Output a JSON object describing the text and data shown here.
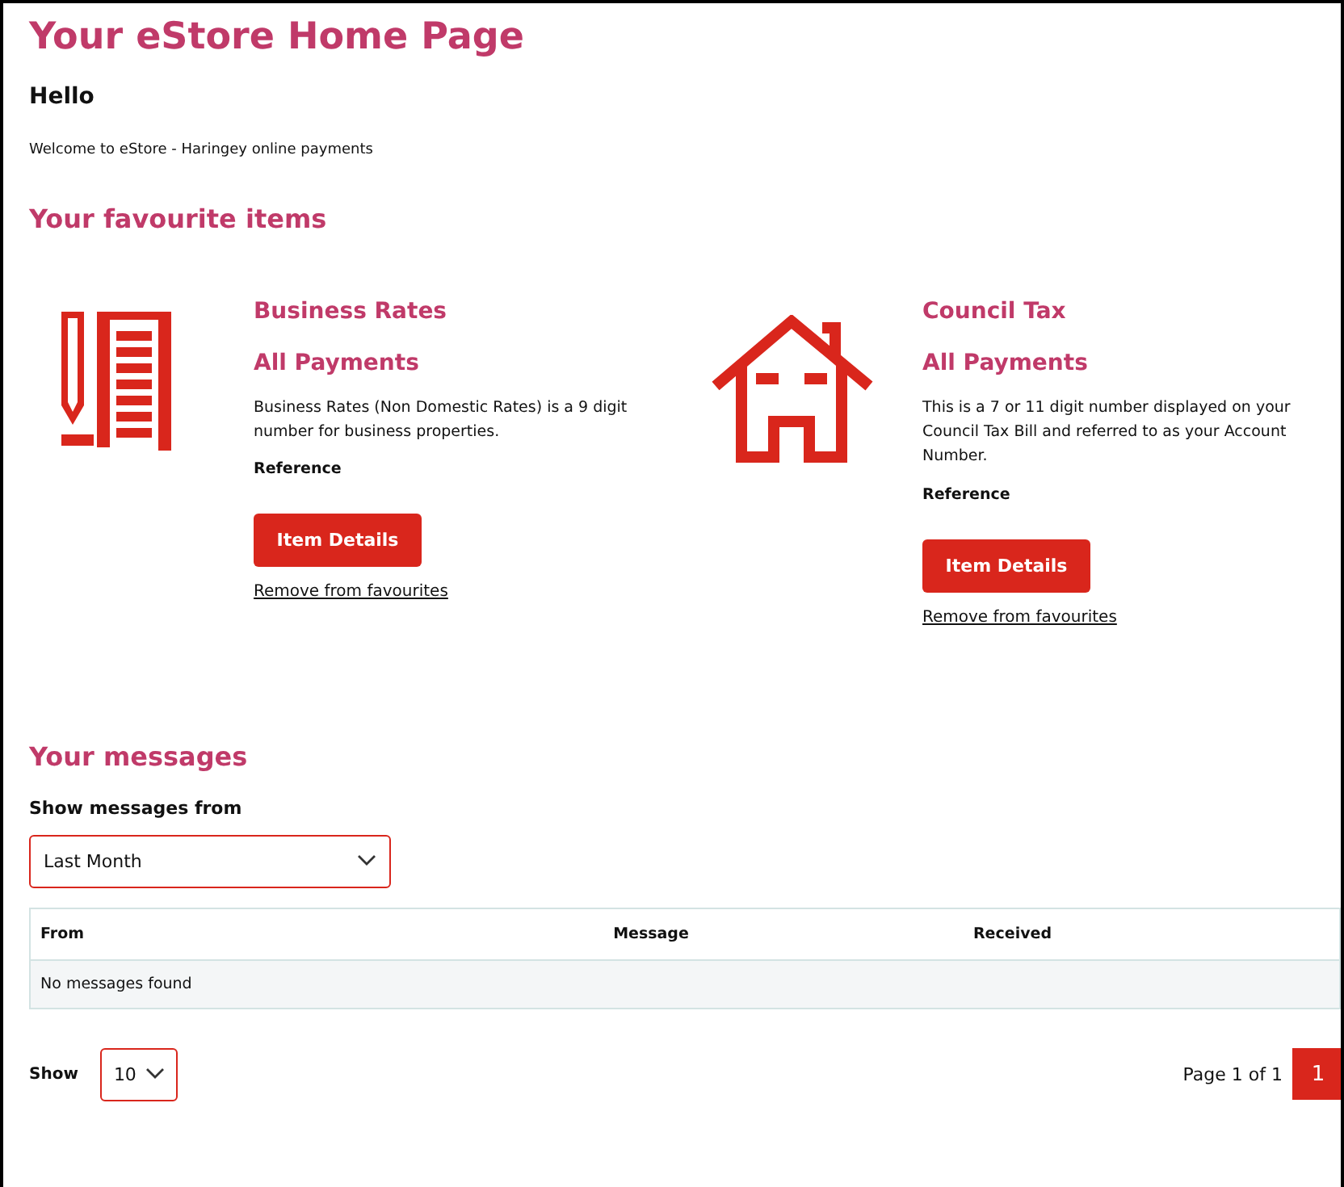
{
  "page_title": "Your eStore Home Page",
  "greeting": "Hello",
  "welcome": "Welcome to eStore - Haringey online payments",
  "favourites": {
    "heading": "Your favourite items",
    "items": [
      {
        "title": "Business Rates",
        "subtitle": "All Payments",
        "description": "Business Rates (Non Domestic Rates) is a 9 digit number for business properties.",
        "reference_label": "Reference",
        "button": "Item Details",
        "remove_link": "Remove from favourites"
      },
      {
        "title": "Council Tax",
        "subtitle": "All Payments",
        "description": "This is a 7 or 11 digit number displayed on your Council Tax Bill and referred to as your Account Number.",
        "reference_label": "Reference",
        "button": "Item Details",
        "remove_link": "Remove from favourites"
      }
    ]
  },
  "messages": {
    "heading": "Your messages",
    "filter_label": "Show messages from",
    "filter_value": "Last Month",
    "table": {
      "columns": [
        "From",
        "Message",
        "Received"
      ],
      "empty_text": "No messages found"
    },
    "show_label": "Show",
    "page_size": "10",
    "page_info": "Page 1 of 1",
    "pages": [
      {
        "label": "1",
        "selected": true
      }
    ]
  }
}
